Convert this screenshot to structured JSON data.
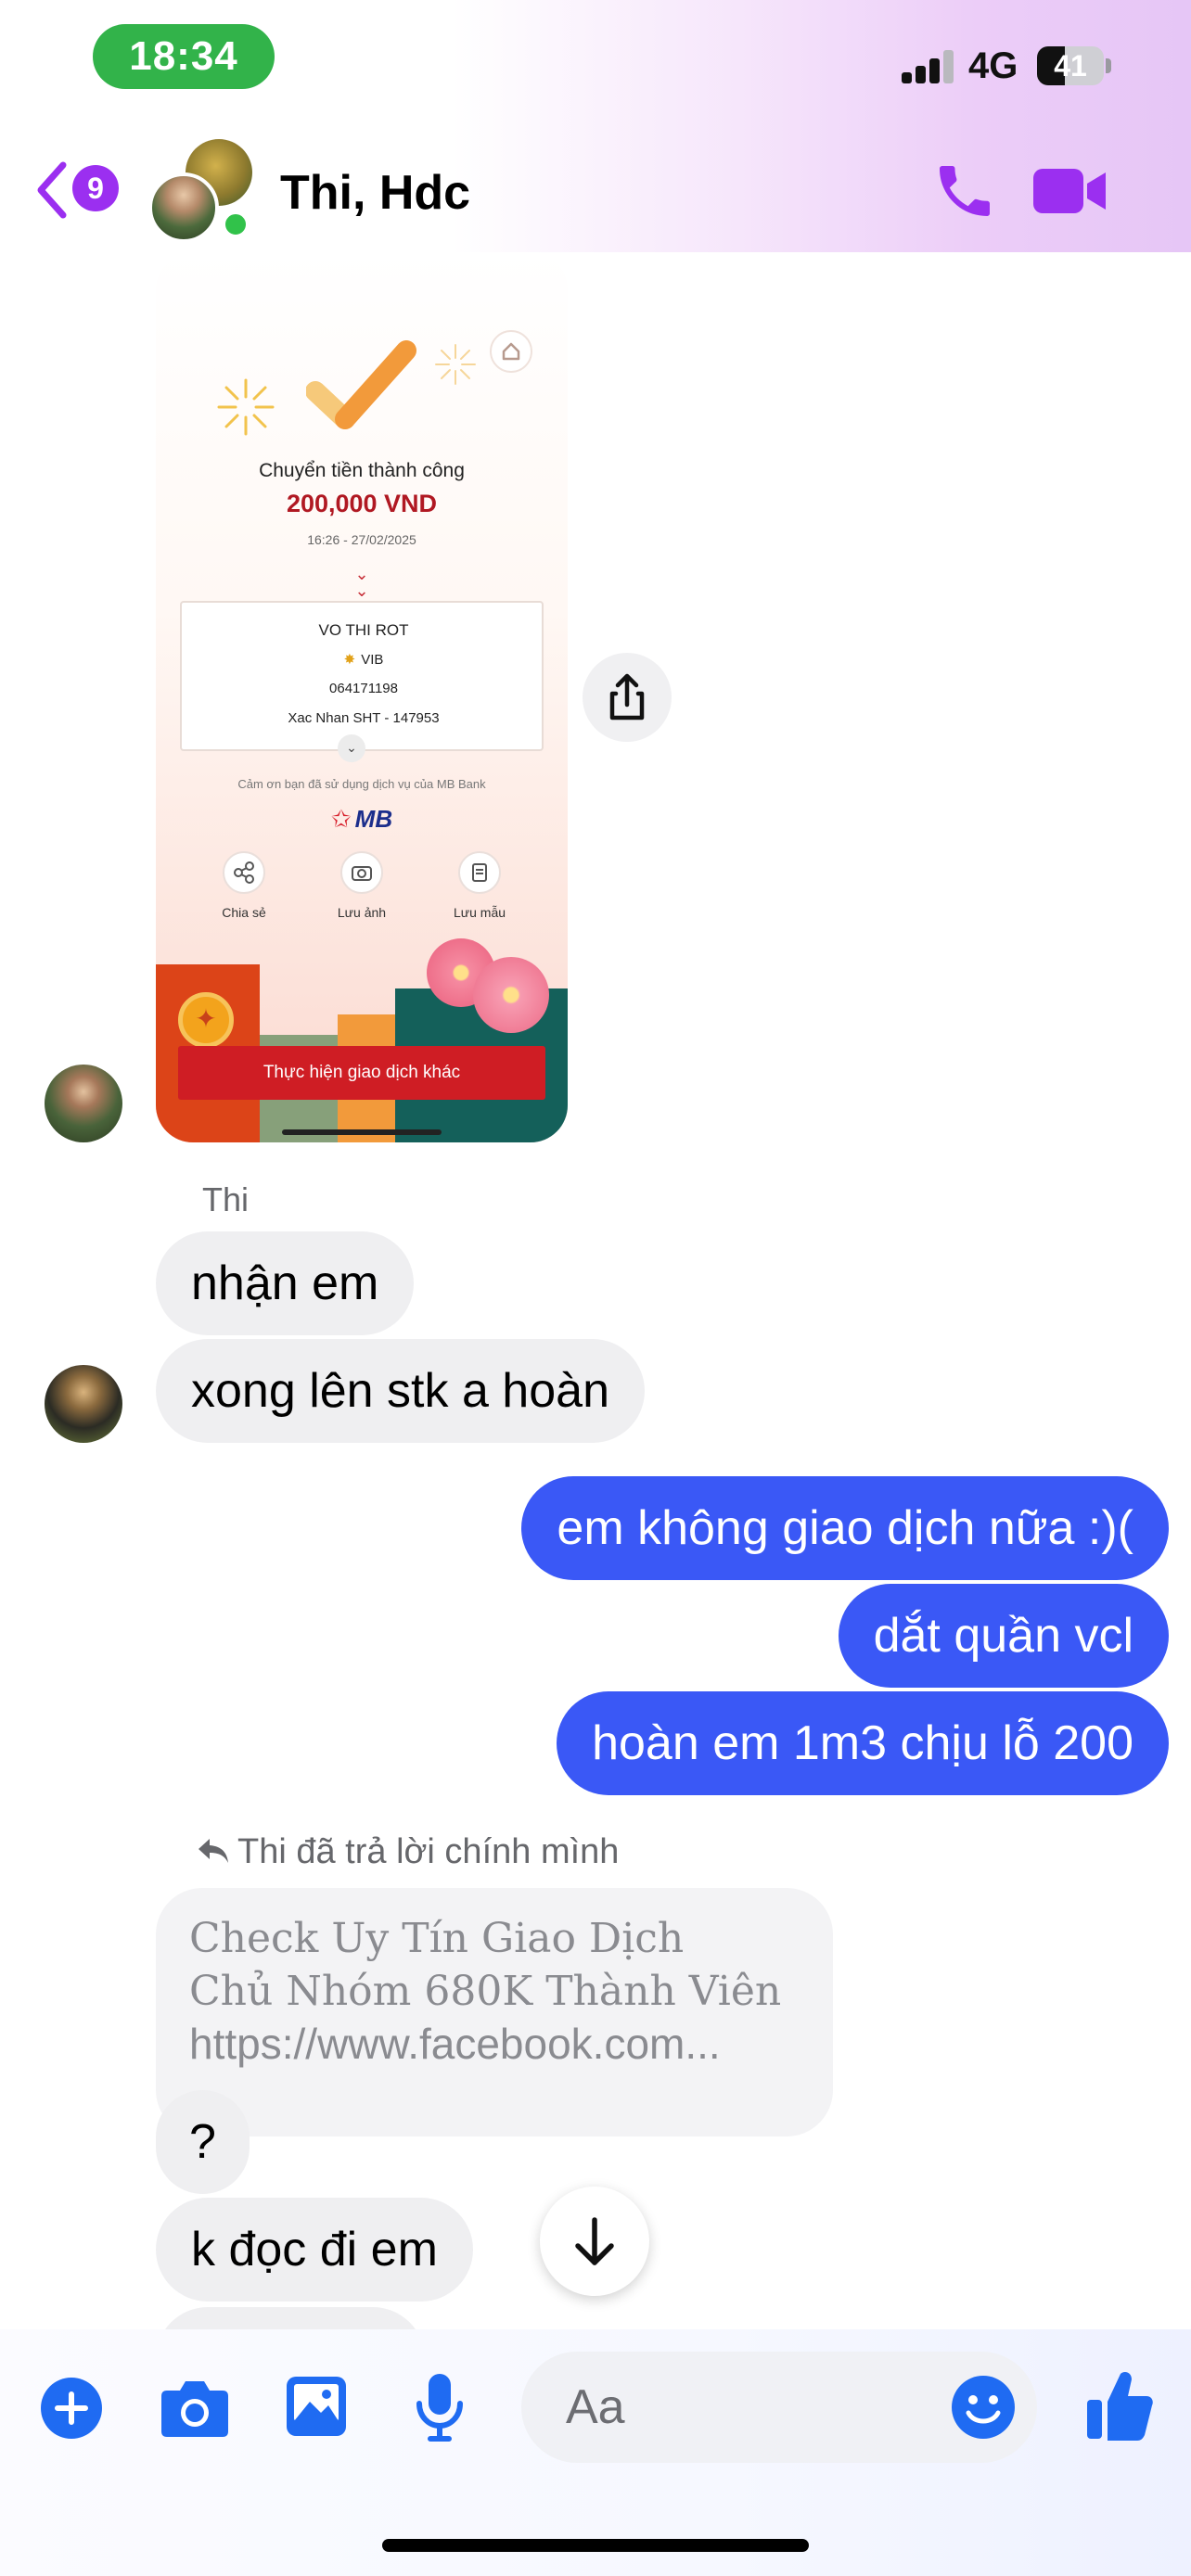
{
  "status_bar": {
    "time": "18:34",
    "network": "4G",
    "battery": "41",
    "battery_level_percent": 41
  },
  "header": {
    "back_badge_count": "9",
    "title": "Thi, Hdc"
  },
  "shared_image": {
    "status_title": "Chuyển tiền thành công",
    "amount": "200,000 VND",
    "datetime": "16:26 - 27/02/2025",
    "recipient_name": "VO THI ROT",
    "recipient_bank": "VIB",
    "account_number": "064171198",
    "memo": "Xac Nhan SHT - 147953",
    "thanks_text": "Cảm ơn bạn đã sử dụng dịch vụ của MB Bank",
    "bank_logo": "MB",
    "actions": [
      "Chia sẻ",
      "Lưu ảnh",
      "Lưu mẫu"
    ],
    "cta_label": "Thực hiện giao dịch khác"
  },
  "messages": {
    "sender_name": "Thi",
    "incoming_1": "nhận em",
    "incoming_2": "xong lên stk a hoàn",
    "outgoing_1": "em không giao dịch nữa :)(",
    "outgoing_2": "dắt quần vcl",
    "outgoing_3": "hoàn em 1m3 chịu lỗ 200",
    "reply_note": "Thi đã trả lời chính mình",
    "quoted_line_1": "Check Uy Tín Giao Dịch",
    "quoted_line_2": "Chủ Nhóm 680K Thành Viên",
    "quoted_line_3": "https://www.facebook.com...",
    "incoming_3": "?",
    "incoming_4": "k đọc đi em"
  },
  "composer": {
    "placeholder": "Aa"
  },
  "colors": {
    "accent": "#9b2ff0",
    "outgoing_bubble": "#3a58f6",
    "composer_icons": "#1f6bf2",
    "online": "#31c24a"
  },
  "icons": [
    "back-chevron-icon",
    "phone-icon",
    "video-camera-icon",
    "share-icon",
    "scroll-down-arrow-icon",
    "plus-icon",
    "camera-icon",
    "gallery-icon",
    "microphone-icon",
    "emoji-icon",
    "thumbs-up-icon"
  ]
}
